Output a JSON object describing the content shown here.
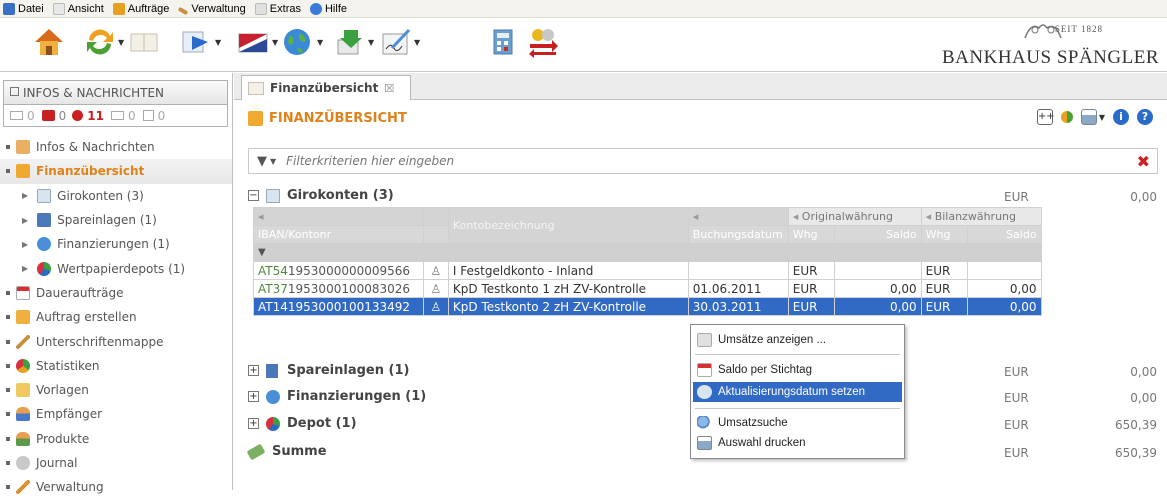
{
  "menubar": {
    "items": [
      {
        "label": "Datei",
        "color": "#3a6fc8"
      },
      {
        "label": "Ansicht",
        "color": "#e8e8e8"
      },
      {
        "label": "Aufträge",
        "color": "#e8a020"
      },
      {
        "label": "Verwaltung",
        "color": "#c89040"
      },
      {
        "label": "Extras",
        "color": "#d8d8d8"
      },
      {
        "label": "Hilfe",
        "color": "#3a7ad8"
      }
    ]
  },
  "toolbar": {
    "icons": [
      "home-icon",
      "refresh-icon",
      "book-icon",
      "transfer-icon",
      "flag-icon",
      "globe-icon",
      "download-icon",
      "signature-icon",
      "calculator-icon",
      "currency-exchange-icon"
    ]
  },
  "logo": {
    "top": "SEIT 1828",
    "main": "BANKHAUS SPÄNGLER"
  },
  "infos": {
    "header": "INFOS & NACHRICHTEN",
    "counts": [
      "0",
      "0",
      "11",
      "0",
      "0"
    ]
  },
  "nav": {
    "items": [
      {
        "label": "Infos & Nachrichten",
        "type": "top"
      },
      {
        "label": "Finanzübersicht",
        "type": "top",
        "active": true
      },
      {
        "label": "Girokonten (3)",
        "type": "sub"
      },
      {
        "label": "Spareinlagen (1)",
        "type": "sub"
      },
      {
        "label": "Finanzierungen (1)",
        "type": "sub"
      },
      {
        "label": "Wertpapierdepots (1)",
        "type": "sub"
      },
      {
        "label": "Daueraufträge",
        "type": "top"
      },
      {
        "label": "Auftrag erstellen",
        "type": "top"
      },
      {
        "label": "Unterschriftenmappe",
        "type": "top"
      },
      {
        "label": "Statistiken",
        "type": "top"
      },
      {
        "label": "Vorlagen",
        "type": "top"
      },
      {
        "label": "Empfänger",
        "type": "top"
      },
      {
        "label": "Produkte",
        "type": "top"
      },
      {
        "label": "Journal",
        "type": "top"
      },
      {
        "label": "Verwaltung",
        "type": "top"
      }
    ]
  },
  "tab": {
    "label": "Finanzübersicht",
    "close": "☒"
  },
  "page": {
    "title": "FINANZÜBERSICHT",
    "filter_placeholder": "Filterkriterien hier eingeben"
  },
  "sections": [
    {
      "label": "Girokonten (3)",
      "expander": "−",
      "currency": "EUR",
      "value": "0,00"
    },
    {
      "label": "Spareinlagen (1)",
      "expander": "+",
      "currency": "EUR",
      "value": "0,00"
    },
    {
      "label": "Finanzierungen (1)",
      "expander": "+",
      "currency": "EUR",
      "value": "0,00"
    },
    {
      "label": "Depot (1)",
      "expander": "+",
      "currency": "EUR",
      "value": "650,39"
    },
    {
      "label": "Summe",
      "expander": "",
      "currency": "EUR",
      "value": "650,39"
    }
  ],
  "grid": {
    "headers": {
      "original": "Originalwährung",
      "bilanz": "Bilanzwährung",
      "iban": "IBAN/Kontonr",
      "bezeichnung": "Kontobezeichnung",
      "datum": "Buchungsdatum",
      "whg": "Whg",
      "saldo": "Saldo"
    },
    "rows": [
      {
        "iban_a": "AT54",
        "iban_b": "1953000000009566",
        "name": "I Festgeldkonto - Inland",
        "date": "",
        "whg1": "EUR",
        "saldo1": "",
        "whg2": "EUR",
        "saldo2": ""
      },
      {
        "iban_a": "AT37",
        "iban_b": "1953000100083026",
        "name": "KpD Testkonto 1 zH ZV-Kontrolle",
        "date": "01.06.2011",
        "whg1": "EUR",
        "saldo1": "0,00",
        "whg2": "EUR",
        "saldo2": "0,00"
      },
      {
        "iban_a": "AT14",
        "iban_b": "1953000100133492",
        "name": "KpD Testkonto 2 zH ZV-Kontrolle",
        "date": "30.03.2011",
        "whg1": "EUR",
        "saldo1": "0,00",
        "whg2": "EUR",
        "saldo2": "0,00",
        "selected": true
      }
    ]
  },
  "context_menu": {
    "items": [
      {
        "label": "Umsätze anzeigen ...",
        "icon": "bookings-icon"
      },
      {
        "label": "Saldo per Stichtag",
        "icon": "calendar-icon"
      },
      {
        "label": "Aktualisierungsdatum setzen",
        "icon": "update-date-icon",
        "highlighted": true
      },
      {
        "label": "Umsatzsuche",
        "icon": "magnifier-icon"
      },
      {
        "label": "Auswahl drucken",
        "icon": "printer-icon"
      }
    ]
  },
  "colors": {
    "accent": "#e0821a",
    "selection": "#316ac5",
    "iban_green": "#4e8a3e",
    "remove": "#d02020"
  }
}
